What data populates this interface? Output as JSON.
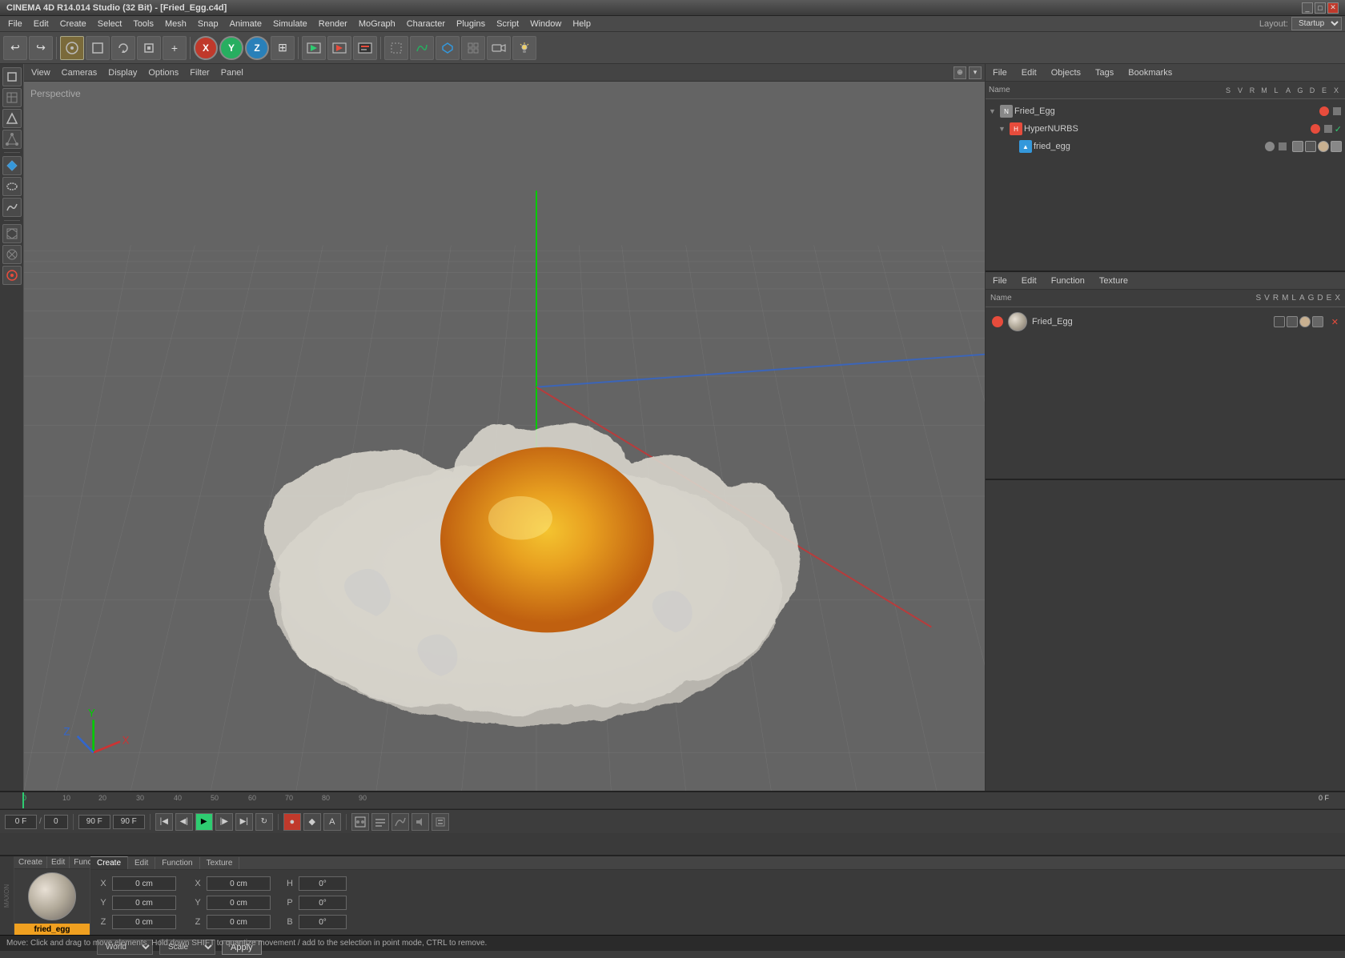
{
  "title_bar": {
    "title": "CINEMA 4D R14.014 Studio (32 Bit) - [Fried_Egg.c4d]",
    "buttons": [
      "minimize",
      "maximize",
      "close"
    ]
  },
  "menu": {
    "items": [
      "File",
      "Edit",
      "Create",
      "Select",
      "Tools",
      "Mesh",
      "Snap",
      "Animate",
      "Simulate",
      "Render",
      "MoGraph",
      "Character",
      "Plugins",
      "Script",
      "Window",
      "Help"
    ],
    "layout_label": "Layout:",
    "layout_value": "Startup"
  },
  "toolbar": {
    "undo_label": "↩",
    "redo_label": "↪",
    "transform_label": "⊕",
    "move_label": "✛",
    "rotate_label": "↻",
    "scale_label": "⊞",
    "x_axis": "X",
    "y_axis": "Y",
    "z_axis": "Z",
    "render_label": "▷"
  },
  "left_toolbar": {
    "tools": [
      "model",
      "polygon",
      "edge",
      "point",
      "object",
      "scene",
      "animation",
      "spline",
      "subdiv",
      "paint"
    ]
  },
  "viewport": {
    "perspective_label": "Perspective",
    "menu_items": [
      "View",
      "Cameras",
      "Display",
      "Options",
      "Filter",
      "Panel"
    ]
  },
  "objects_panel": {
    "menu_items": [
      "File",
      "Edit",
      "Objects",
      "Tags",
      "Bookmarks"
    ],
    "header_cols": [
      "Name",
      "S",
      "V",
      "R",
      "M",
      "L",
      "A",
      "G",
      "D",
      "E",
      "X"
    ],
    "objects": [
      {
        "name": "Fried_Egg",
        "indent": 0,
        "type": "null",
        "has_expand": true,
        "dot_color": "#e74c3c"
      },
      {
        "name": "HyperNURBS",
        "indent": 1,
        "type": "hypernurbs",
        "has_expand": true,
        "dot_color": "#e74c3c",
        "check_mark": true
      },
      {
        "name": "fried_egg",
        "indent": 2,
        "type": "mesh",
        "has_expand": false,
        "dot_color": "#888"
      }
    ]
  },
  "materials_panel": {
    "menu_items": [
      "File",
      "Edit",
      "Function",
      "Texture"
    ],
    "header_cols": [
      "Name",
      "S",
      "V",
      "R",
      "M",
      "L",
      "A",
      "G",
      "D",
      "E",
      "X"
    ],
    "materials": [
      {
        "name": "Fried_Egg",
        "thumb_color": "#c8b090",
        "dot_color": "#e74c3c"
      }
    ]
  },
  "timeline": {
    "frame_start": "0",
    "frame_end": "90 F",
    "current_frame": "0 F",
    "fps_label": "F",
    "frame_range": "90 F",
    "markers": [
      "0",
      "10",
      "20",
      "30",
      "40",
      "50",
      "60",
      "70",
      "80",
      "90"
    ]
  },
  "coordinates": {
    "tabs": [
      "Create",
      "Edit",
      "Function",
      "Texture"
    ],
    "x_pos": "0 cm",
    "y_pos": "0 cm",
    "z_pos": "0 cm",
    "x_rot": "0 cm",
    "y_rot": "0 cm",
    "z_rot": "0 cm",
    "h_val": "0°",
    "p_val": "0°",
    "b_val": "0°",
    "world_label": "World",
    "scale_label": "Scale",
    "apply_label": "Apply"
  },
  "material_preview": {
    "name": "fried_egg"
  },
  "status_bar": {
    "text": "Move: Click and drag to move elements. Hold down SHIFT to quantize movement / add to the selection in point mode, CTRL to remove."
  }
}
